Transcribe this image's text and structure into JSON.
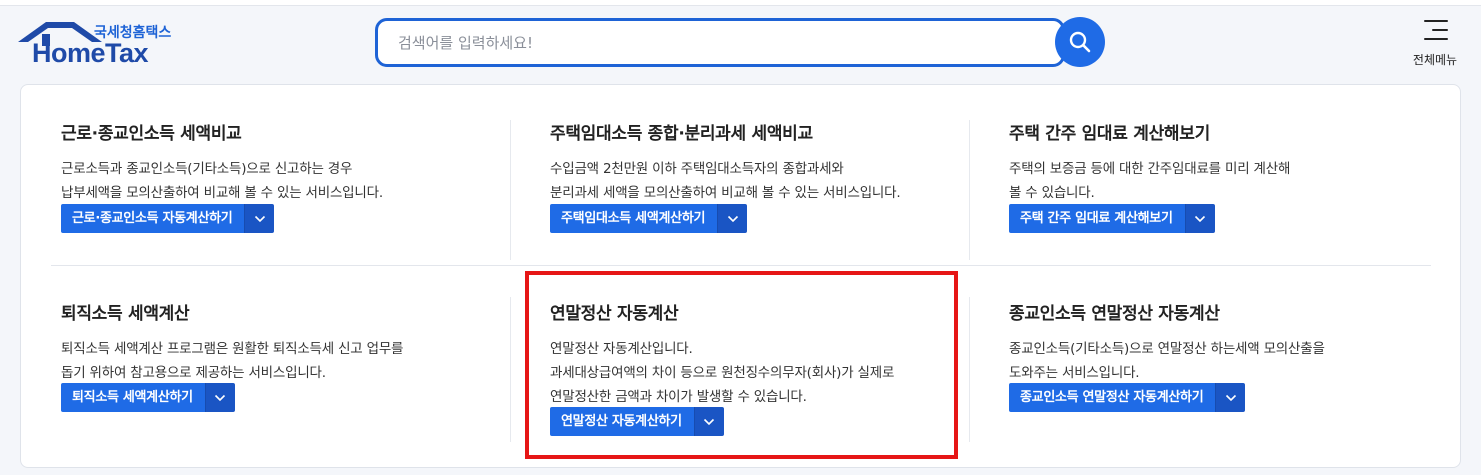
{
  "header": {
    "logo_sub": "국세청홈택스",
    "logo_main": "HomeTax",
    "search_placeholder": "검색어를 입력하세요!",
    "menu_label": "전체메뉴",
    "icons": {
      "search": "search-icon",
      "menu": "hamburger-menu-icon",
      "logo": "house-roof-icon"
    }
  },
  "cards": [
    {
      "title": "근로·종교인소득 세액비교",
      "desc": [
        "근로소득과 종교인소득(기타소득)으로 신고하는 경우",
        "납부세액을 모의산출하여 비교해 볼 수 있는 서비스입니다."
      ],
      "button": "근로·종교인소득 자동계산하기"
    },
    {
      "title": "주택임대소득 종합·분리과세 세액비교",
      "desc": [
        "수입금액 2천만원 이하 주택임대소득자의 종합과세와",
        "분리과세 세액을 모의산출하여 비교해 볼 수 있는 서비스입니다."
      ],
      "button": "주택임대소득 세액계산하기"
    },
    {
      "title": "주택 간주 임대료 계산해보기",
      "desc": [
        "주택의 보증금 등에 대한 간주임대료를 미리 계산해",
        "볼 수 있습니다."
      ],
      "button": "주택 간주 임대료 계산해보기"
    },
    {
      "title": "퇴직소득 세액계산",
      "desc": [
        "퇴직소득 세액계산 프로그램은 원활한 퇴직소득세 신고 업무를",
        "돕기 위하여 참고용으로 제공하는 서비스입니다."
      ],
      "button": "퇴직소득 세액계산하기"
    },
    {
      "title": "연말정산 자동계산",
      "desc": [
        "연말정산 자동계산입니다.",
        "과세대상급여액의 차이 등으로 원천징수의무자(회사)가 실제로",
        "연말정산한 금액과 차이가 발생할 수 있습니다."
      ],
      "button": "연말정산 자동계산하기"
    },
    {
      "title": "종교인소득 연말정산 자동계산",
      "desc": [
        "종교인소득(기타소득)으로 연말정산 하는세액 모의산출을",
        "도와주는 서비스입니다."
      ],
      "button": "종교인소득 연말정산 자동계산하기"
    }
  ],
  "colors": {
    "primary": "#1f6be6",
    "primary_dark": "#1a55c4",
    "logo": "#1f4aa8",
    "highlight": "#e61616"
  }
}
